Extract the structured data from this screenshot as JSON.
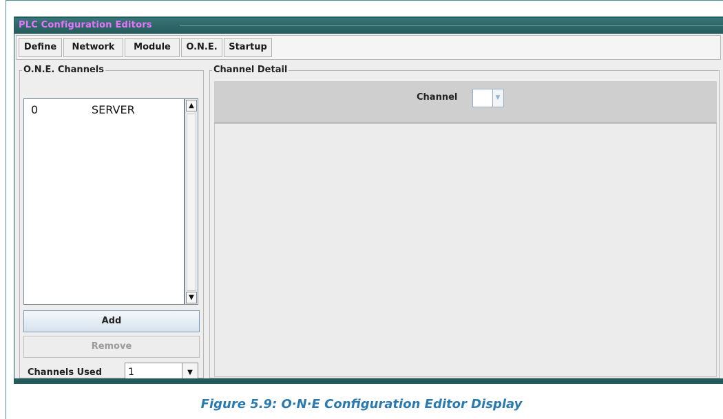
{
  "window": {
    "title": "PLC Configuration Editors"
  },
  "tabs": [
    {
      "label": "Define"
    },
    {
      "label": "Network"
    },
    {
      "label": "Module"
    },
    {
      "label": "O.N.E."
    },
    {
      "label": "Startup"
    }
  ],
  "channels_panel": {
    "title": "O.N.E. Channels",
    "items": [
      {
        "number": "0",
        "name": "SERVER"
      }
    ],
    "add_label": "Add",
    "remove_label": "Remove",
    "channels_used_label": "Channels Used",
    "channels_used_value": "1"
  },
  "detail_panel": {
    "title": "Channel Detail",
    "channel_label": "Channel",
    "channel_value": ""
  },
  "icons": {
    "scroll_up": "up-arrow-icon",
    "scroll_down": "down-arrow-icon",
    "dropdown": "chevron-down-icon"
  },
  "colors": {
    "title_text": "#e873ff",
    "titlebar": "#245a5c",
    "caption": "#2a7ab0"
  },
  "caption": "Figure 5.9: O·N·E Configuration Editor Display"
}
